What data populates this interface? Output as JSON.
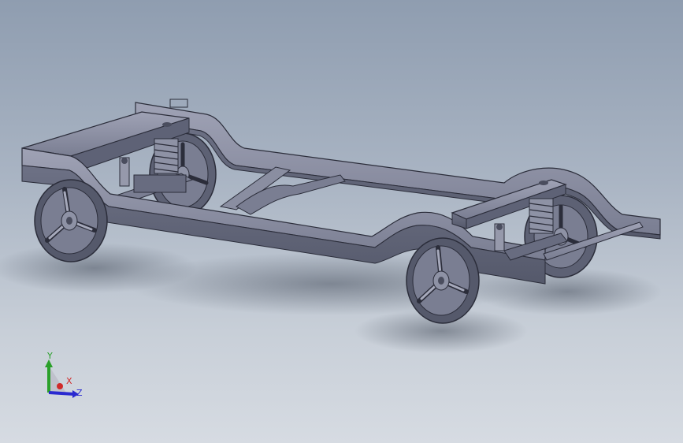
{
  "viewport": {
    "background_top": "#8f9db0",
    "background_bottom": "#d6dbe2"
  },
  "model": {
    "part_color": "#6e7286",
    "edge_color": "#2b2d3a",
    "highlight_color": "#a6a9bb"
  },
  "triad": {
    "x_label": "X",
    "y_label": "Y",
    "z_label": "Z",
    "x_color": "#d02a2a",
    "y_color": "#2aa02a",
    "z_color": "#2a2ad0"
  }
}
